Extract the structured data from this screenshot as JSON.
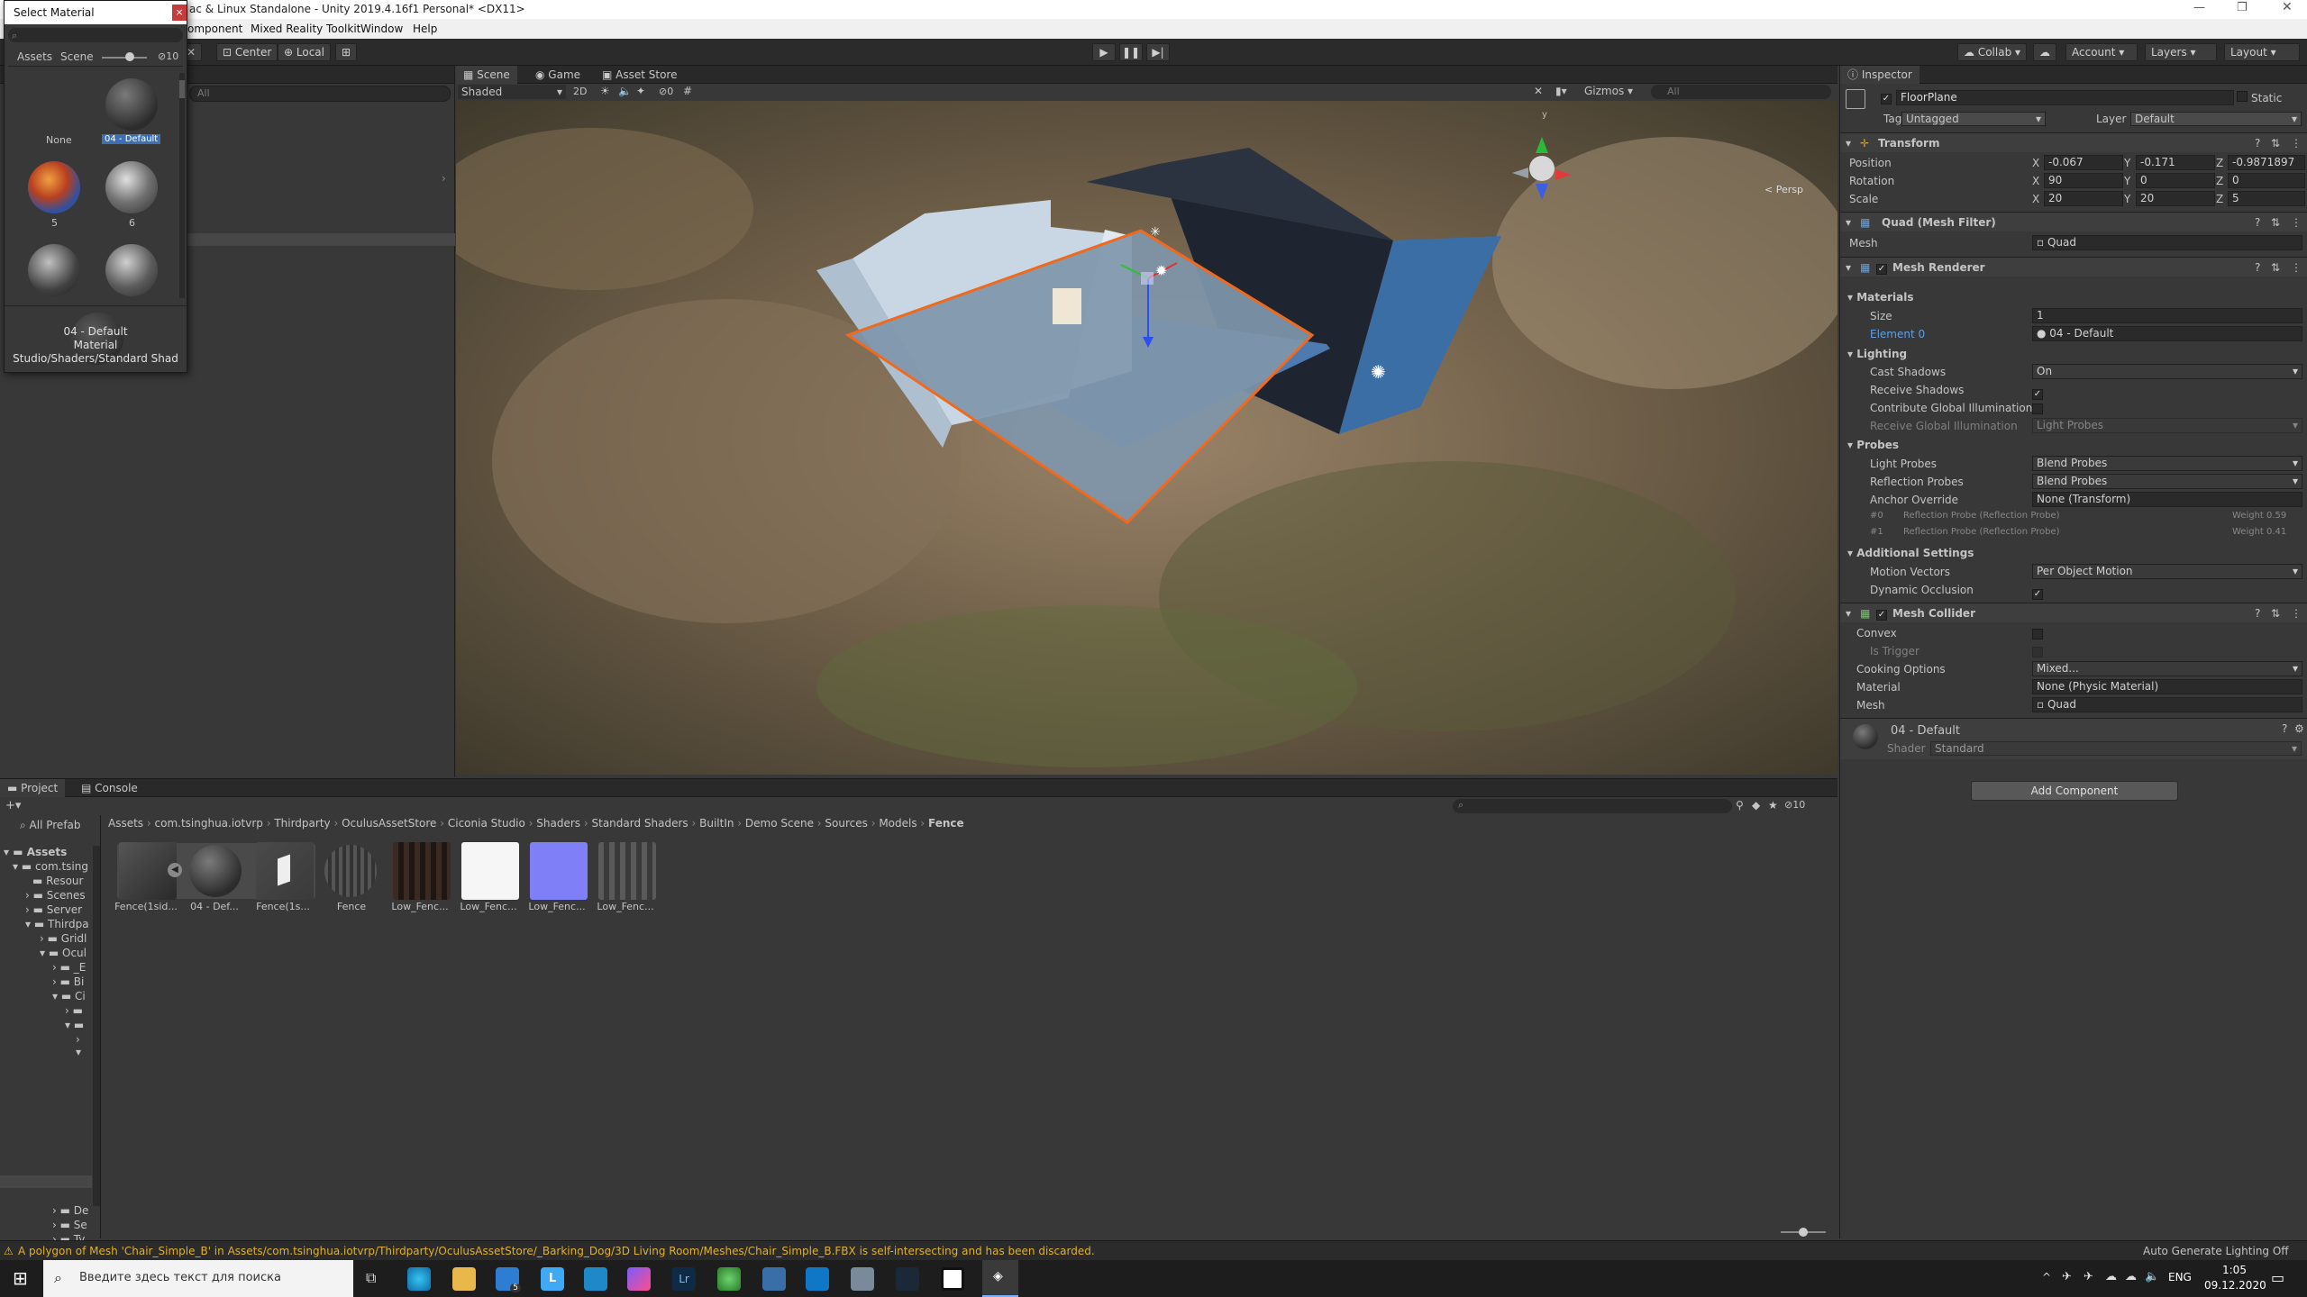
{
  "window": {
    "title": "ac & Linux Standalone - Unity 2019.4.16f1 Personal* <DX11>"
  },
  "menu": {
    "items": [
      "omponent",
      "Mixed Reality Toolkit",
      "Window",
      "Help"
    ]
  },
  "toolbar": {
    "center": "Center",
    "local": "Local",
    "collab": "Collab",
    "account": "Account",
    "layers": "Layers",
    "layout": "Layout"
  },
  "select_material": {
    "title": "Select Material",
    "tab_assets": "Assets",
    "tab_scene": "Scene",
    "count": "10",
    "items": [
      {
        "label": "None"
      },
      {
        "label": "04 - Default"
      },
      {
        "label": "5"
      },
      {
        "label": "6"
      }
    ],
    "preview_name": "04 - Default",
    "preview_type": "Material",
    "preview_shader": "Studio/Shaders/Standard Shad"
  },
  "hierarchy": {
    "search_placeholder": "All"
  },
  "scene": {
    "tabs": [
      "Scene",
      "Game",
      "Asset Store"
    ],
    "shading": "Shaded",
    "mode2d": "2D",
    "gizmo_count": "0",
    "gizmos": "Gizmos",
    "search_placeholder": "All",
    "persp": "< Persp"
  },
  "inspector": {
    "tab": "Inspector",
    "object_name": "FloorPlane",
    "static_label": "Static",
    "tag_label": "Tag",
    "tag": "Untagged",
    "layer_label": "Layer",
    "layer": "Default",
    "transform": {
      "title": "Transform",
      "position_label": "Position",
      "rotation_label": "Rotation",
      "scale_label": "Scale",
      "position": [
        "-0.067",
        "-0.171",
        "-0.9871897"
      ],
      "rotation": [
        "90",
        "0",
        "0"
      ],
      "scale": [
        "20",
        "20",
        "5"
      ]
    },
    "mesh_filter": {
      "title": "Quad (Mesh Filter)",
      "mesh_label": "Mesh",
      "mesh": "Quad"
    },
    "mesh_renderer": {
      "title": "Mesh Renderer",
      "materials": "Materials",
      "size_label": "Size",
      "size": "1",
      "element0_label": "Element 0",
      "element0": "04 - Default",
      "lighting": "Lighting",
      "cast_shadows_label": "Cast Shadows",
      "cast_shadows": "On",
      "receive_shadows_label": "Receive Shadows",
      "contribute_gi_label": "Contribute Global Illumination",
      "receive_gi_label": "Receive Global Illumination",
      "receive_gi": "Light Probes",
      "probes": "Probes",
      "light_probes_label": "Light Probes",
      "light_probes": "Blend Probes",
      "reflection_probes_label": "Reflection Probes",
      "reflection_probes": "Blend Probes",
      "anchor_label": "Anchor Override",
      "anchor": "None (Transform)",
      "probe0": "Reflection Probe (Reflection Probe)",
      "probe0_weight": "Weight 0.59",
      "probe1": "Reflection Probe (Reflection Probe)",
      "probe1_weight": "Weight 0.41",
      "probe0_idx": "#0",
      "probe1_idx": "#1",
      "additional": "Additional Settings",
      "motion_label": "Motion Vectors",
      "motion": "Per Object Motion",
      "occlusion_label": "Dynamic Occlusion"
    },
    "mesh_collider": {
      "title": "Mesh Collider",
      "convex_label": "Convex",
      "trigger_label": "Is Trigger",
      "cooking_label": "Cooking Options",
      "cooking": "Mixed...",
      "material_label": "Material",
      "material": "None (Physic Material)",
      "mesh_label": "Mesh",
      "mesh": "Quad"
    },
    "material": {
      "name": "04 - Default",
      "shader_label": "Shader",
      "shader": "Standard"
    },
    "add_component": "Add Component"
  },
  "project": {
    "tabs": [
      "Project",
      "Console"
    ],
    "count": "10",
    "all_prefabs": "All Prefab",
    "breadcrumb": [
      "Assets",
      "com.tsinghua.iotvrp",
      "Thirdparty",
      "OculusAssetStore",
      "Ciconia Studio",
      "Shaders",
      "Standard Shaders",
      "BuiltIn",
      "Demo Scene",
      "Sources",
      "Models",
      "Fence"
    ],
    "tree": [
      "Assets",
      "com.tsing",
      "Resour",
      "Scenes",
      "Server",
      "Thirdpa",
      "Gridl",
      "Ocul",
      "_E",
      "Bi",
      "Ci",
      "De",
      "Se",
      "Ty"
    ],
    "assets": [
      "Fence(1sid...",
      "04 - Def...",
      "Fence(1s...",
      "Fence",
      "Low_Fenc...",
      "Low_Fenc...",
      "Low_Fenc...",
      "Low_Fenc..."
    ]
  },
  "status": {
    "warning": "A polygon of Mesh 'Chair_Simple_B' in Assets/com.tsinghua.iotvrp/Thirdparty/OculusAssetStore/_Barking_Dog/3D Living Room/Meshes/Chair_Simple_B.FBX is self-intersecting and has been discarded.",
    "lighting": "Auto Generate Lighting Off"
  },
  "taskbar": {
    "search_placeholder": "Введите здесь текст для поиска",
    "lang": "ENG",
    "time": "1:05",
    "date": "09.12.2020",
    "mail_badge": "5"
  }
}
